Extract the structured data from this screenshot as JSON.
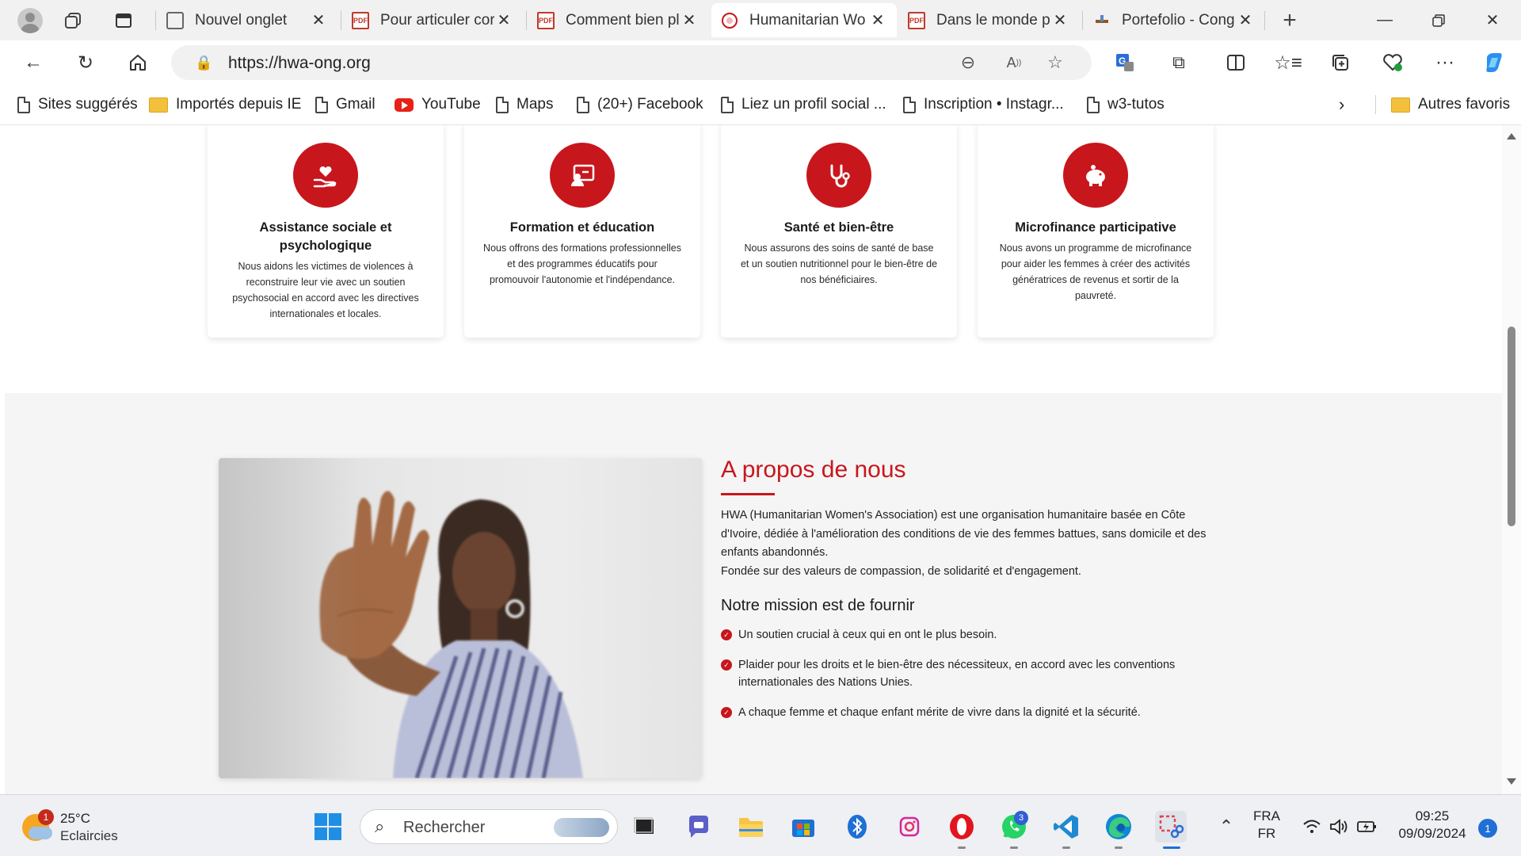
{
  "browser": {
    "tabs": [
      {
        "title": "Nouvel onglet",
        "icon": "new-tab-icon"
      },
      {
        "title": "Pour articuler cor",
        "icon": "pdf-icon"
      },
      {
        "title": "Comment bien pl",
        "icon": "pdf-icon"
      },
      {
        "title": "Humanitarian Wo",
        "icon": "site-icon",
        "active": true
      },
      {
        "title": "Dans le monde pr",
        "icon": "pdf-icon"
      },
      {
        "title": "Portefolio - Cong",
        "icon": "site-icon"
      }
    ],
    "url": "https://hwa-ong.org",
    "favorites": [
      {
        "label": "Sites suggérés",
        "icon": "page-icon"
      },
      {
        "label": "Importés depuis IE",
        "icon": "folder-icon"
      },
      {
        "label": "Gmail",
        "icon": "page-icon"
      },
      {
        "label": "YouTube",
        "icon": "youtube-icon"
      },
      {
        "label": "Maps",
        "icon": "page-icon"
      },
      {
        "label": "(20+) Facebook",
        "icon": "page-icon"
      },
      {
        "label": "Liez un profil social ...",
        "icon": "page-icon"
      },
      {
        "label": "Inscription • Instagr...",
        "icon": "page-icon"
      },
      {
        "label": "w3-tutos",
        "icon": "page-icon"
      }
    ],
    "other_favorites": "Autres favoris"
  },
  "services": [
    {
      "title": "Assistance sociale et psychologique",
      "text": "Nous aidons les victimes de violences à reconstruire leur vie avec un soutien psychosocial en accord avec les directives internationales et locales.",
      "icon": "heart-hand-icon"
    },
    {
      "title": "Formation et éducation",
      "text": "Nous offrons des formations professionnelles et des programmes éducatifs pour promouvoir l'autonomie et l'indépendance.",
      "icon": "teacher-board-icon"
    },
    {
      "title": "Santé et bien-être",
      "text": "Nous assurons des soins de santé de base et un soutien nutritionnel pour le bien-être de nos bénéficiaires.",
      "icon": "stethoscope-icon"
    },
    {
      "title": "Microfinance participative",
      "text": "Nous avons un programme de microfinance pour aider les femmes à créer des activités génératrices de revenus et sortir de la pauvreté.",
      "icon": "piggy-bank-icon"
    }
  ],
  "about": {
    "title": "A propos de nous",
    "paragraph1": "HWA (Humanitarian Women's Association) est une organisation humanitaire basée en Côte d'Ivoire, dédiée à l'amélioration des conditions de vie des femmes battues, sans domicile et des enfants abandonnés.",
    "paragraph2": "Fondée sur des valeurs de compassion, de solidarité et d'engagement.",
    "mission_title": "Notre mission est de fournir",
    "mission_items": [
      "Un soutien crucial à ceux qui en ont le plus besoin.",
      "Plaider pour les droits et le bien-être des nécessiteux, en accord avec les conventions internationales des Nations Unies.",
      "A chaque femme et chaque enfant mérite de vivre dans la dignité et la sécurité."
    ]
  },
  "taskbar": {
    "weather_temp": "25°C",
    "weather_cond": "Eclaircies",
    "weather_badge": "1",
    "search_placeholder": "Rechercher",
    "whatsapp_badge": "3",
    "lang_top": "FRA",
    "lang_bottom": "FR",
    "time": "09:25",
    "date": "09/09/2024",
    "notifications": "1"
  },
  "colors": {
    "accent": "#c8161d",
    "about_bg": "#f5f5f5"
  }
}
